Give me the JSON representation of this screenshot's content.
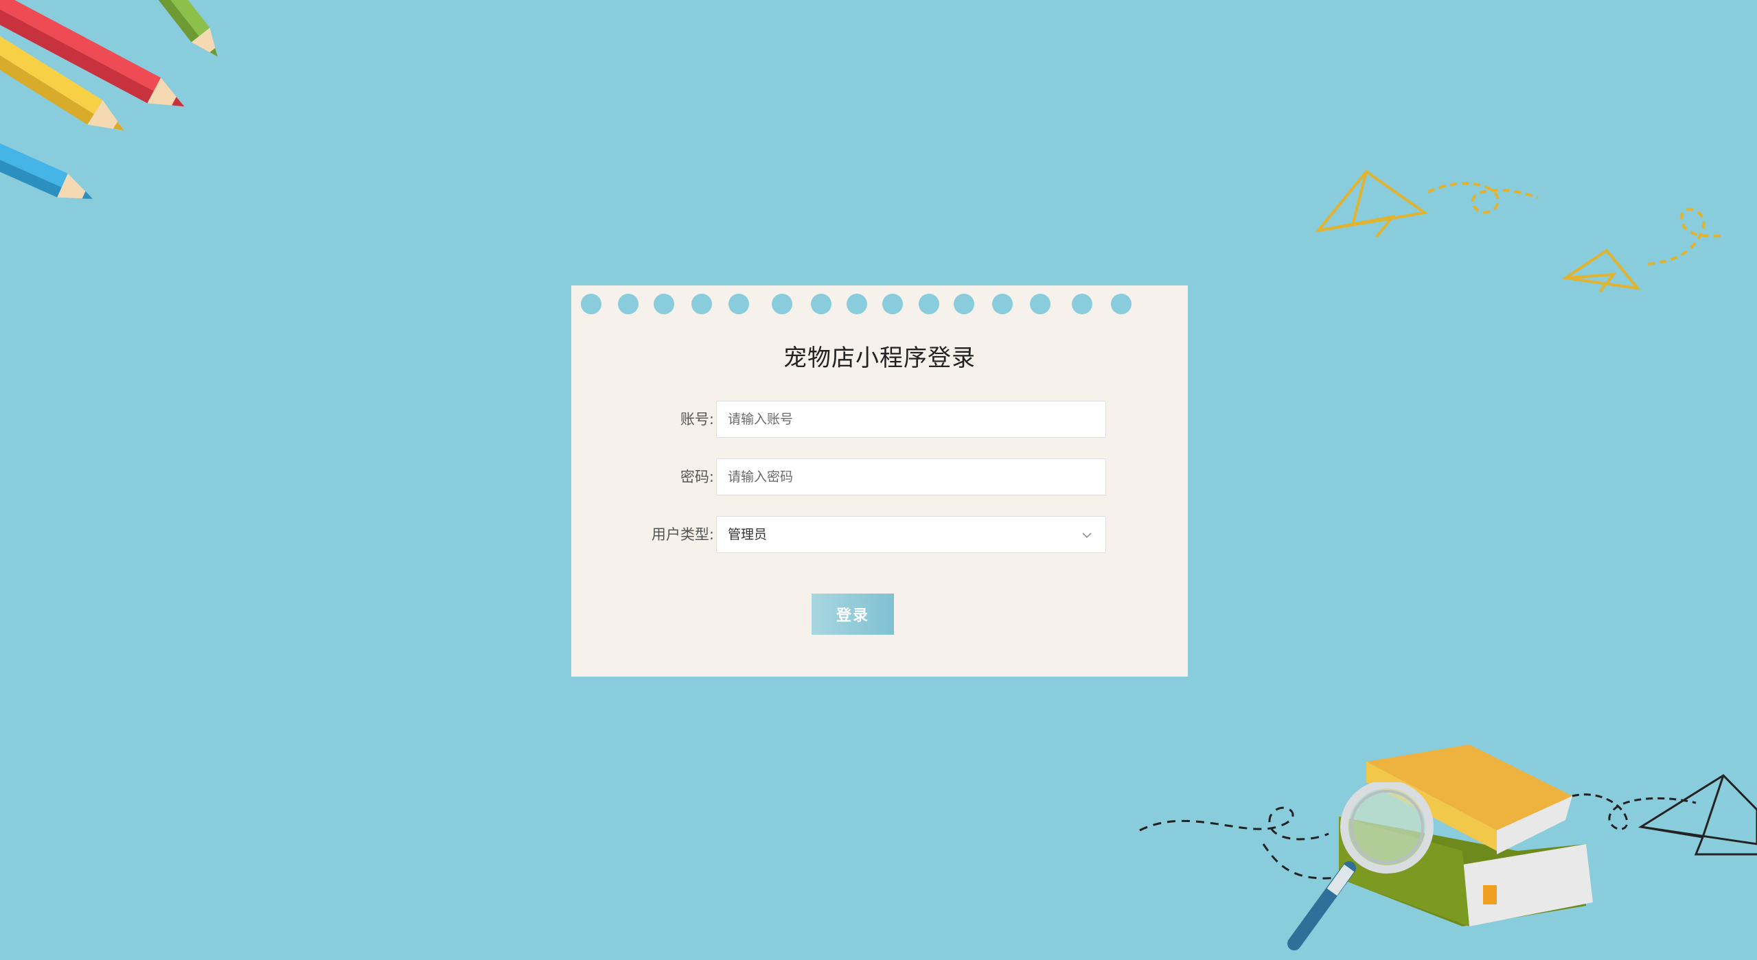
{
  "login": {
    "title": "宠物店小程序登录",
    "account_label": "账号:",
    "account_placeholder": "请输入账号",
    "password_label": "密码:",
    "password_placeholder": "请输入密码",
    "usertype_label": "用户类型:",
    "usertype_value": "管理员",
    "submit_label": "登录"
  },
  "colors": {
    "background": "#89ccdc",
    "card": "#f7f1ec",
    "button": "#7fc1d2"
  },
  "decorations": [
    "pencils-illustration",
    "paper-plane-icon",
    "books-illustration",
    "magnifier-icon"
  ]
}
